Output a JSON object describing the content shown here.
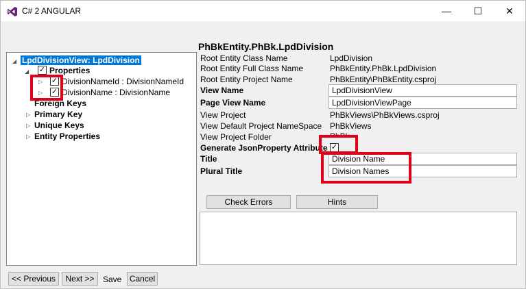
{
  "window": {
    "title": "C# 2 ANGULAR",
    "minimize_glyph": "—",
    "maximize_glyph": "☐",
    "close_glyph": "✕"
  },
  "tree": {
    "root_label": "LpdDivisionView: LpdDivision",
    "properties_label": "Properties",
    "properties_checked": true,
    "property_items": [
      {
        "label": "DivisionNameId : DivisionNameId",
        "checked": true
      },
      {
        "label": "DivisionName : DivisionName",
        "checked": true
      }
    ],
    "foreign_keys_label": "Foreign Keys",
    "primary_key_label": "Primary Key",
    "unique_keys_label": "Unique Keys",
    "entity_properties_label": "Entity Properties"
  },
  "details": {
    "header": "PhBkEntity.PhBk.LpdDivision",
    "root_entity_class_name_label": "Root Entity Class Name",
    "root_entity_class_name_value": "LpdDivision",
    "root_entity_full_class_name_label": "Root Entity Full Class Name",
    "root_entity_full_class_name_value": "PhBkEntity.PhBk.LpdDivision",
    "root_entity_project_name_label": "Root Entity Project Name",
    "root_entity_project_name_value": "PhBkEntity\\PhBkEntity.csproj",
    "view_name_label": "View Name",
    "view_name_value": "LpdDivisionView",
    "page_view_name_label": "Page View Name",
    "page_view_name_value": "LpdDivisionViewPage",
    "view_project_label": "View Project",
    "view_project_value": "PhBkViews\\PhBkViews.csproj",
    "view_default_ns_label": "View Default Project NameSpace",
    "view_default_ns_value": "PhBkViews",
    "view_project_folder_label": "View Project Folder",
    "view_project_folder_value": "PhBk",
    "generate_json_label": "Generate JsonProperty Attribute",
    "generate_json_checked": true,
    "title_label": "Title",
    "title_value": "Division Name",
    "plural_title_label": "Plural Title",
    "plural_title_value": "Division Names",
    "check_errors_label": "Check Errors",
    "hints_label": "Hints"
  },
  "footer": {
    "previous_label": "<< Previous",
    "next_label": "Next >>",
    "save_label": "Save",
    "cancel_label": "Cancel"
  },
  "glyphs": {
    "check": "✓",
    "expanded": "◢",
    "collapsed": "▷"
  },
  "colors": {
    "selection": "#0078d7",
    "highlight_box": "#e0001b",
    "vs_icon": "#68217a"
  }
}
